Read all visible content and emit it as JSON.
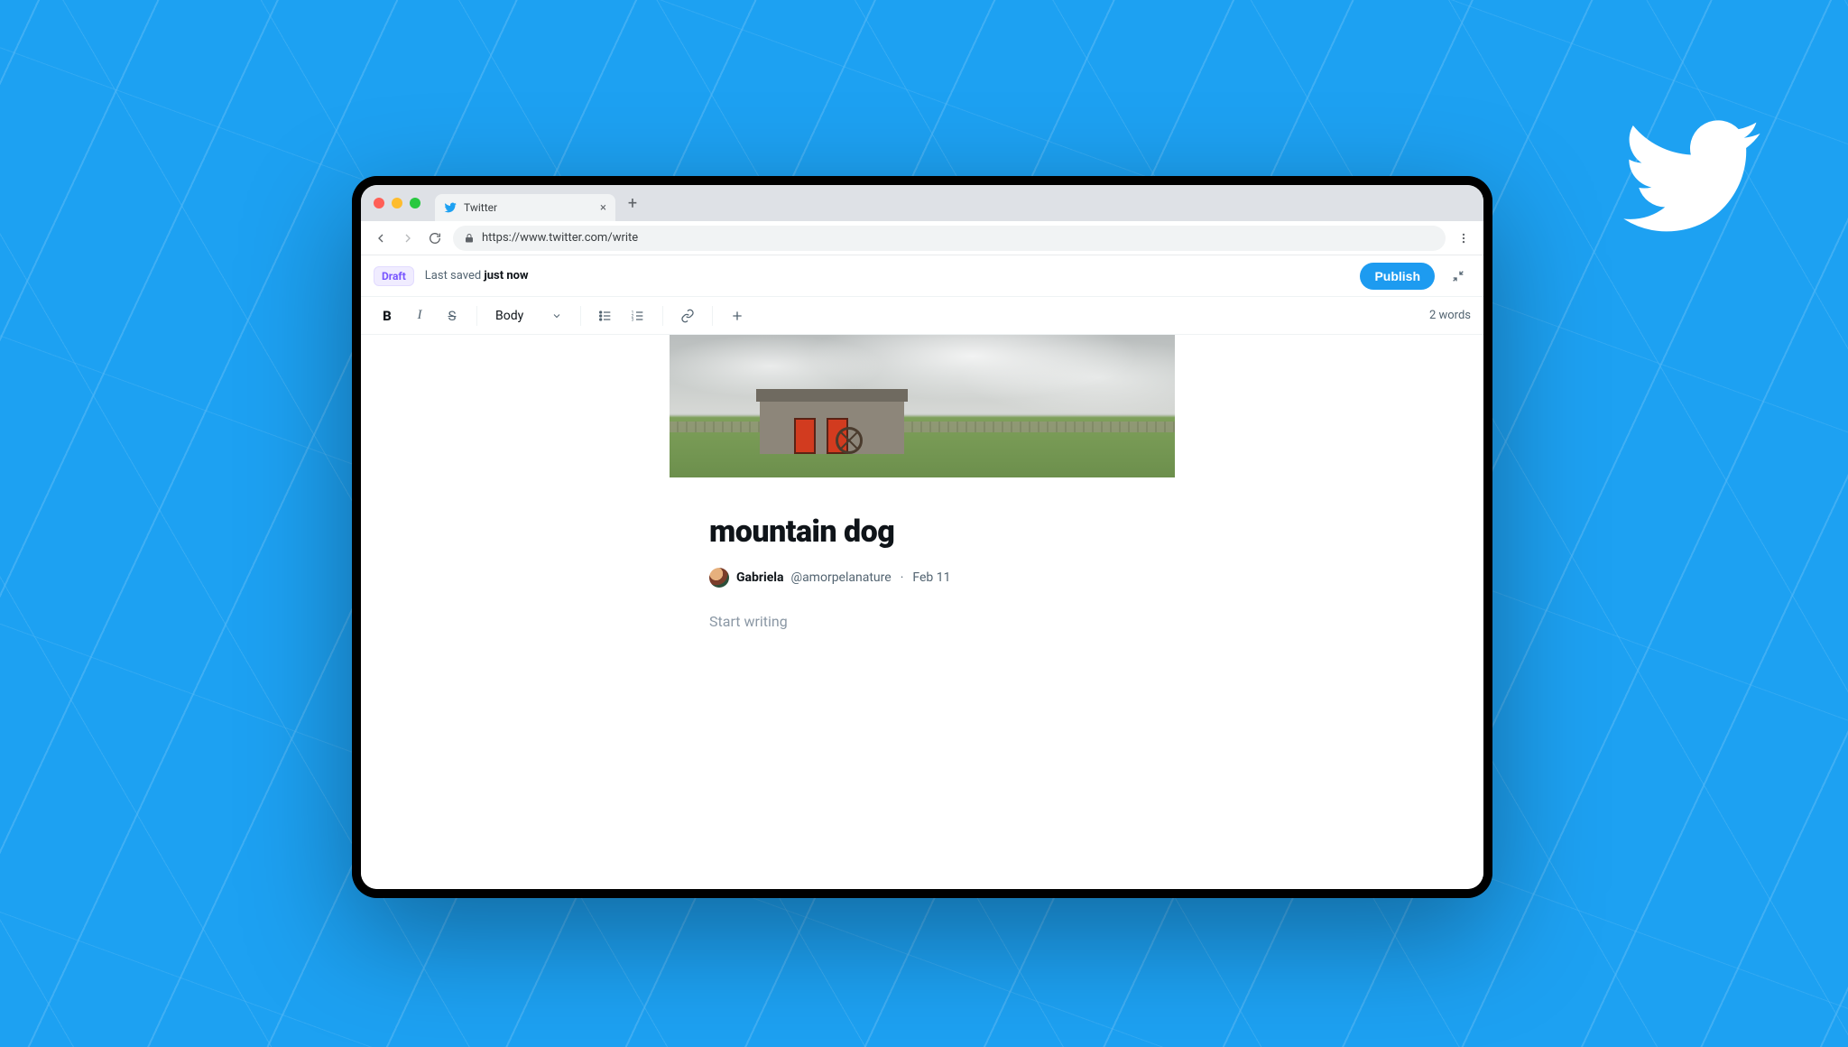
{
  "browser": {
    "tab_title": "Twitter",
    "url_display": "https://www.twitter.com/write",
    "url_scheme_secure": true
  },
  "header": {
    "draft_pill": "Draft",
    "last_saved_prefix": "Last saved ",
    "last_saved_value": "just now",
    "publish_label": "Publish"
  },
  "toolbar": {
    "bold": "B",
    "italic": "I",
    "strike": "S",
    "style_label": "Body",
    "word_count": "2 words"
  },
  "post": {
    "title": "mountain dog",
    "author_name": "Gabriela",
    "author_handle": "@amorpelanature",
    "date": "Feb 11",
    "body_placeholder": "Start writing"
  }
}
